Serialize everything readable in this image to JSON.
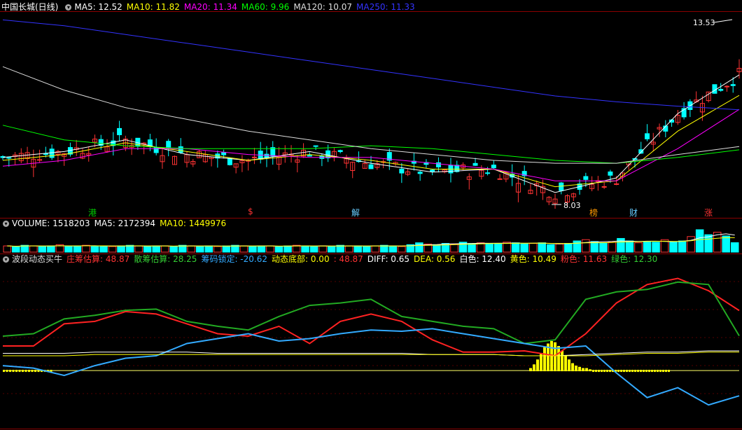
{
  "main": {
    "title": "中国长城(日线)",
    "ma_labels": [
      {
        "text": "MA5: 12.52",
        "color": "#ffffff"
      },
      {
        "text": "MA10: 11.82",
        "color": "#ffff00"
      },
      {
        "text": "MA20: 11.34",
        "color": "#ff00ff"
      },
      {
        "text": "MA60: 9.96",
        "color": "#00ff00"
      },
      {
        "text": "MA120: 10.07",
        "color": "#dddddd"
      },
      {
        "text": "MA250: 11.33",
        "color": "#3333ff"
      }
    ],
    "high_label": "13.53",
    "low_label": "8.03",
    "markers": [
      {
        "text": "港",
        "color": "#00cc00"
      },
      {
        "text": "$",
        "color": "#ff3333"
      },
      {
        "text": "解",
        "color": "#66ccff"
      },
      {
        "text": "榜",
        "color": "#ff9900"
      },
      {
        "text": "财",
        "color": "#66ccff"
      },
      {
        "text": "涨",
        "color": "#ff3333"
      }
    ]
  },
  "volume": {
    "labels": [
      {
        "text": "VOLUME: 1518203",
        "color": "#ffffff"
      },
      {
        "text": "MA5: 2172394",
        "color": "#ffffff"
      },
      {
        "text": "MA10: 1449976",
        "color": "#ffff00"
      }
    ]
  },
  "indicator": {
    "labels": [
      {
        "text": "波段动态买牛",
        "color": "#dddddd"
      },
      {
        "text": "庄筹估算: 48.87",
        "color": "#ff3333"
      },
      {
        "text": "散筹估算: 28.25",
        "color": "#33cc33"
      },
      {
        "text": "筹码锁定: -20.62",
        "color": "#33aaff"
      },
      {
        "text": "动态底部: 0.00",
        "color": "#ffff00"
      },
      {
        "text": ": 48.87",
        "color": "#ff3333"
      },
      {
        "text": "DIFF: 0.65",
        "color": "#ffffff"
      },
      {
        "text": "DEA: 0.56",
        "color": "#ffff00"
      },
      {
        "text": "白色: 12.40",
        "color": "#ffffff"
      },
      {
        "text": "黄色: 10.49",
        "color": "#ffff00"
      },
      {
        "text": "粉色: 11.63",
        "color": "#ff3333"
      },
      {
        "text": "绿色: 12.30",
        "color": "#33cc33"
      }
    ]
  },
  "chart_data": [
    {
      "type": "line",
      "title": "中国长城(日线)",
      "x": [
        0,
        10,
        20,
        30,
        40,
        50,
        60,
        70,
        80,
        90,
        100,
        110,
        120
      ],
      "series": [
        {
          "name": "MA5",
          "color": "#ffffff",
          "values": [
            9.7,
            9.9,
            10.3,
            9.8,
            9.6,
            9.9,
            9.5,
            9.2,
            9.3,
            8.5,
            9.0,
            11.2,
            12.52
          ]
        },
        {
          "name": "MA10",
          "color": "#ffff00",
          "values": [
            9.6,
            9.8,
            10.2,
            9.9,
            9.6,
            9.8,
            9.6,
            9.3,
            9.3,
            8.7,
            8.9,
            10.6,
            11.82
          ]
        },
        {
          "name": "MA20",
          "color": "#ff00ff",
          "values": [
            9.4,
            9.6,
            10.0,
            10.0,
            9.8,
            9.7,
            9.7,
            9.5,
            9.3,
            8.9,
            8.9,
            10.0,
            11.34
          ]
        },
        {
          "name": "MA60",
          "color": "#00ff00",
          "values": [
            10.8,
            10.3,
            10.1,
            10.0,
            10.0,
            10.0,
            10.1,
            10.0,
            9.8,
            9.6,
            9.5,
            9.7,
            9.96
          ]
        },
        {
          "name": "MA120",
          "color": "#dddddd",
          "values": [
            12.8,
            12.0,
            11.4,
            11.0,
            10.6,
            10.3,
            10.0,
            9.8,
            9.6,
            9.5,
            9.5,
            9.8,
            10.07
          ]
        },
        {
          "name": "MA250",
          "color": "#3333ff",
          "values": [
            14.4,
            14.2,
            13.9,
            13.6,
            13.3,
            13.0,
            12.7,
            12.4,
            12.1,
            11.8,
            11.6,
            11.45,
            11.33
          ]
        }
      ],
      "high": 13.53,
      "low": 8.03,
      "ylim": [
        7.9,
        14.6
      ]
    },
    {
      "type": "bar",
      "title": "VOLUME",
      "values": [
        1.0,
        0.9,
        1.1,
        1.0,
        0.9,
        1.0,
        1.2,
        0.9,
        1.0,
        1.1,
        0.9,
        1.0,
        0.9,
        1.0,
        1.1,
        1.0,
        0.9,
        1.0,
        1.0,
        0.9,
        1.1,
        1.0,
        0.9,
        1.0,
        0.9,
        1.0,
        1.1,
        1.0,
        0.9,
        1.0,
        1.0,
        0.9,
        1.0,
        1.1,
        1.0,
        0.9,
        1.0,
        0.9,
        1.1,
        1.0,
        1.0,
        0.9,
        1.0,
        1.1,
        1.0,
        0.9,
        1.2,
        1.5,
        1.3,
        1.2,
        1.4,
        1.3,
        1.6,
        1.4,
        1.5,
        1.3,
        1.4,
        1.6,
        1.5,
        1.3,
        1.4,
        1.5,
        1.2,
        1.3,
        1.4,
        1.8,
        2.0,
        1.7,
        1.5,
        1.6,
        2.2,
        1.8,
        1.5,
        1.7,
        1.6,
        2.0,
        1.6,
        1.8,
        2.5,
        3.6,
        2.8,
        3.2,
        2.6,
        1.5182
      ],
      "ma5_last": 2.172394,
      "ma10_last": 1.449976
    },
    {
      "type": "line",
      "title": "波段动态买牛",
      "x": [
        0,
        5,
        10,
        15,
        20,
        25,
        30,
        35,
        40,
        45,
        50,
        55,
        60,
        65,
        70,
        75,
        80,
        85,
        90,
        95,
        100,
        105,
        110,
        115,
        120
      ],
      "series": [
        {
          "name": "庄筹估算",
          "color": "#ff2222",
          "values": [
            20,
            20,
            38,
            40,
            48,
            46,
            38,
            30,
            28,
            36,
            22,
            40,
            46,
            40,
            25,
            15,
            15,
            16,
            12,
            30,
            55,
            70,
            75,
            65,
            48.87
          ]
        },
        {
          "name": "散筹估算",
          "color": "#22aa22",
          "values": [
            28,
            30,
            42,
            45,
            49,
            50,
            40,
            36,
            33,
            44,
            53,
            55,
            58,
            44,
            40,
            36,
            34,
            22,
            25,
            58,
            64,
            66,
            72,
            70,
            28.25
          ]
        },
        {
          "name": "筹码锁定",
          "color": "#33aaff",
          "values": [
            4,
            2,
            -4,
            4,
            10,
            12,
            22,
            26,
            30,
            24,
            26,
            30,
            33,
            32,
            34,
            30,
            26,
            22,
            18,
            20,
            -2,
            -22,
            -14,
            -28,
            -20.62
          ]
        },
        {
          "name": "DIFF",
          "color": "#ffffff",
          "values": [
            14,
            14,
            14,
            15,
            15,
            15,
            15,
            14,
            14,
            14,
            14,
            14,
            14,
            14,
            13,
            13,
            13,
            12,
            12,
            13,
            14,
            15,
            15,
            16,
            16
          ]
        },
        {
          "name": "DEA",
          "color": "#ffff00",
          "values": [
            12,
            12,
            12,
            13,
            13,
            13,
            13,
            13,
            13,
            13,
            13,
            13,
            13,
            13,
            13,
            13,
            13,
            12,
            12,
            12,
            13,
            14,
            14,
            15,
            15
          ]
        }
      ],
      "ylim": [
        -45,
        85
      ]
    }
  ]
}
